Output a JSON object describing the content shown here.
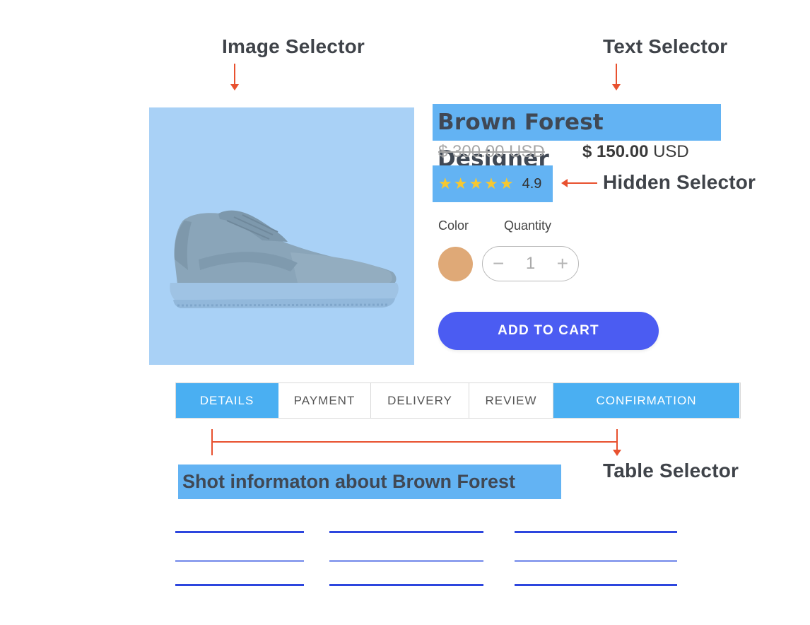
{
  "annotations": {
    "image_selector": "Image Selector",
    "text_selector": "Text Selector",
    "hidden_selector": "Hidden Selector",
    "table_selector": "Table Selector"
  },
  "product": {
    "title": "Brown Forest Designer",
    "old_price": "$ 300.00 USD",
    "new_price_amount": "$ 150.00",
    "new_price_currency": "USD",
    "stars": "★★★★★",
    "rating": "4.9",
    "color_label": "Color",
    "quantity_label": "Quantity",
    "color_swatch": "#dfa977",
    "quantity_minus": "−",
    "quantity_value": "1",
    "quantity_plus": "+",
    "add_to_cart": "ADD TO CART"
  },
  "tabs": [
    {
      "label": "DETAILS",
      "active": true
    },
    {
      "label": "PAYMENT",
      "active": false
    },
    {
      "label": "DELIVERY",
      "active": false
    },
    {
      "label": "REVIEW",
      "active": false
    },
    {
      "label": "CONFIRMATION",
      "active": true
    }
  ],
  "short_info": "Shot informaton about Brown Forest",
  "colors": {
    "annotation_arrow": "#e8512f",
    "selector_highlight": "#63b3f3",
    "image_overlay": "#a9d1f6",
    "cart_button": "#4b5cf2",
    "tab_active": "#4aaff2",
    "placeholder_dark": "#2d46de",
    "placeholder_light": "#8ea0ee"
  }
}
